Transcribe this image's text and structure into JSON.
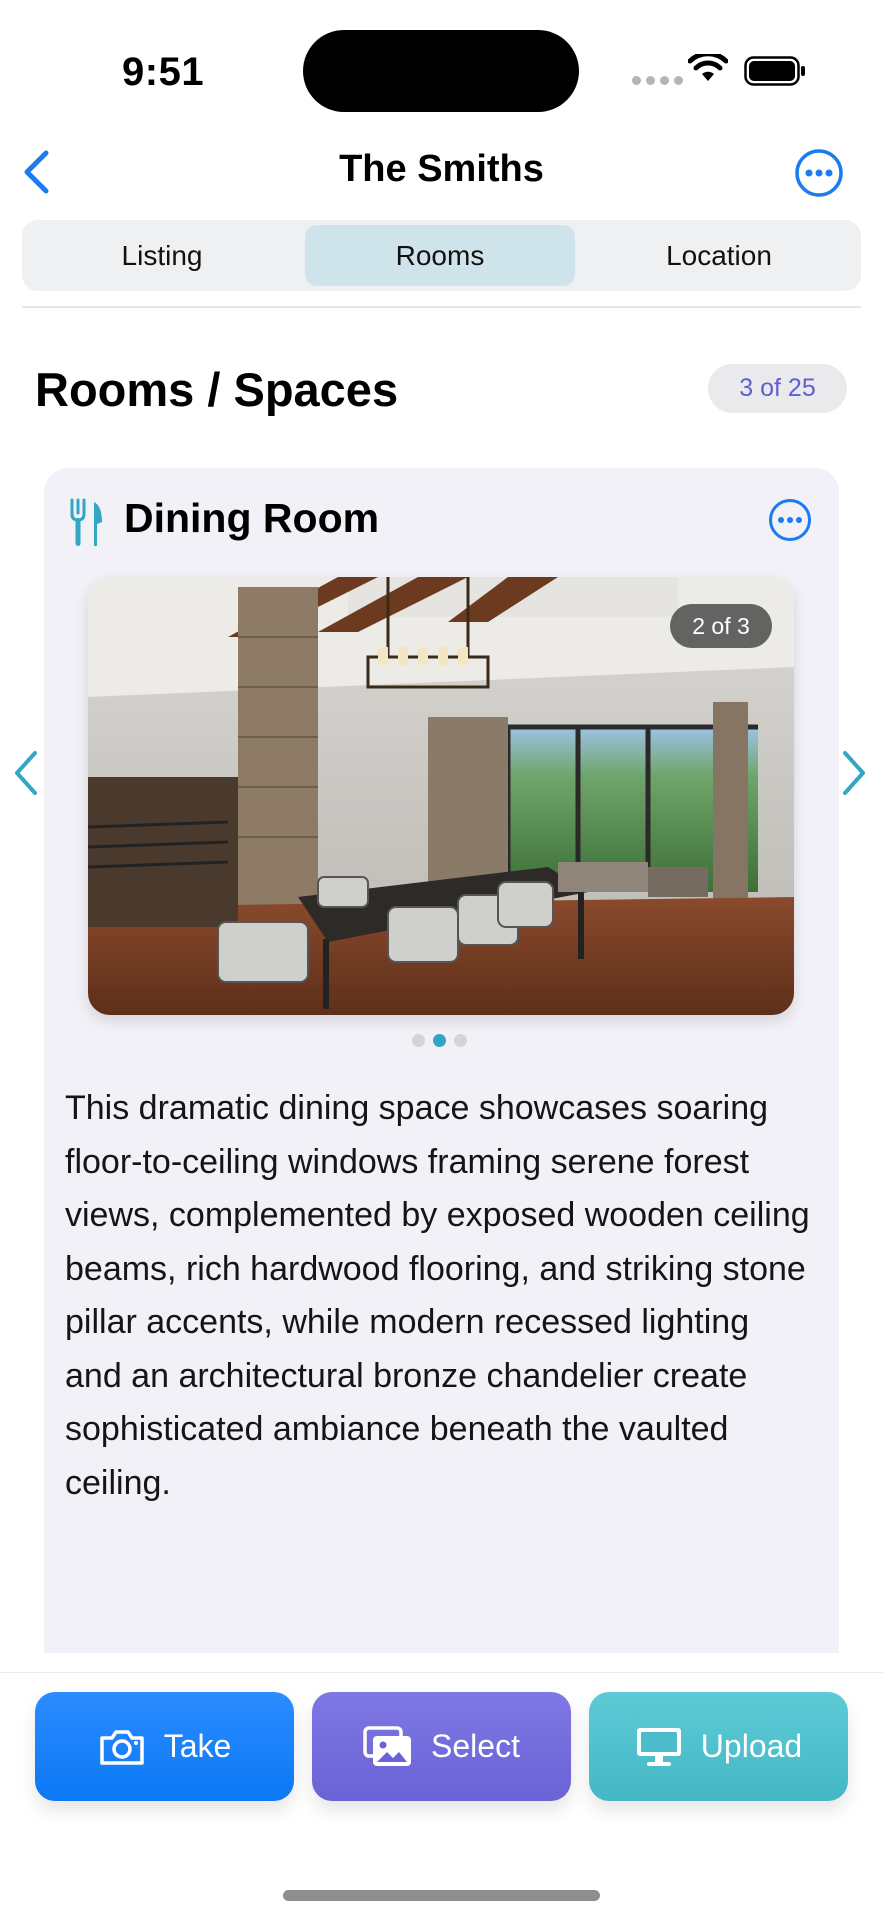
{
  "status": {
    "time": "9:51"
  },
  "nav": {
    "title": "The Smiths"
  },
  "tabs": [
    "Listing",
    "Rooms",
    "Location"
  ],
  "selected_tab": "Rooms",
  "section": {
    "title": "Rooms / Spaces",
    "count": "3 of 25"
  },
  "room": {
    "title": "Dining Room",
    "photo_counter": "2 of 3",
    "photo_count": 3,
    "active_photo": 2,
    "description": "This dramatic dining space showcases soaring floor-to-ceiling windows framing serene forest views, complemented by exposed wooden ceiling beams, rich hardwood flooring, and striking stone pillar accents, while modern recessed lighting and an architectural bronze chandelier create sophisticated ambiance beneath the vaulted ceiling."
  },
  "actions": {
    "take": "Take",
    "select": "Select",
    "upload": "Upload"
  },
  "colors": {
    "accent": "#1a7cf0",
    "teal": "#35a5c4",
    "badge_text": "#5f5fd0"
  },
  "icons": [
    "chevron-left-icon",
    "ellipsis-circle-icon",
    "fork-knife-icon",
    "camera-icon",
    "photo-stack-icon",
    "monitor-icon"
  ]
}
